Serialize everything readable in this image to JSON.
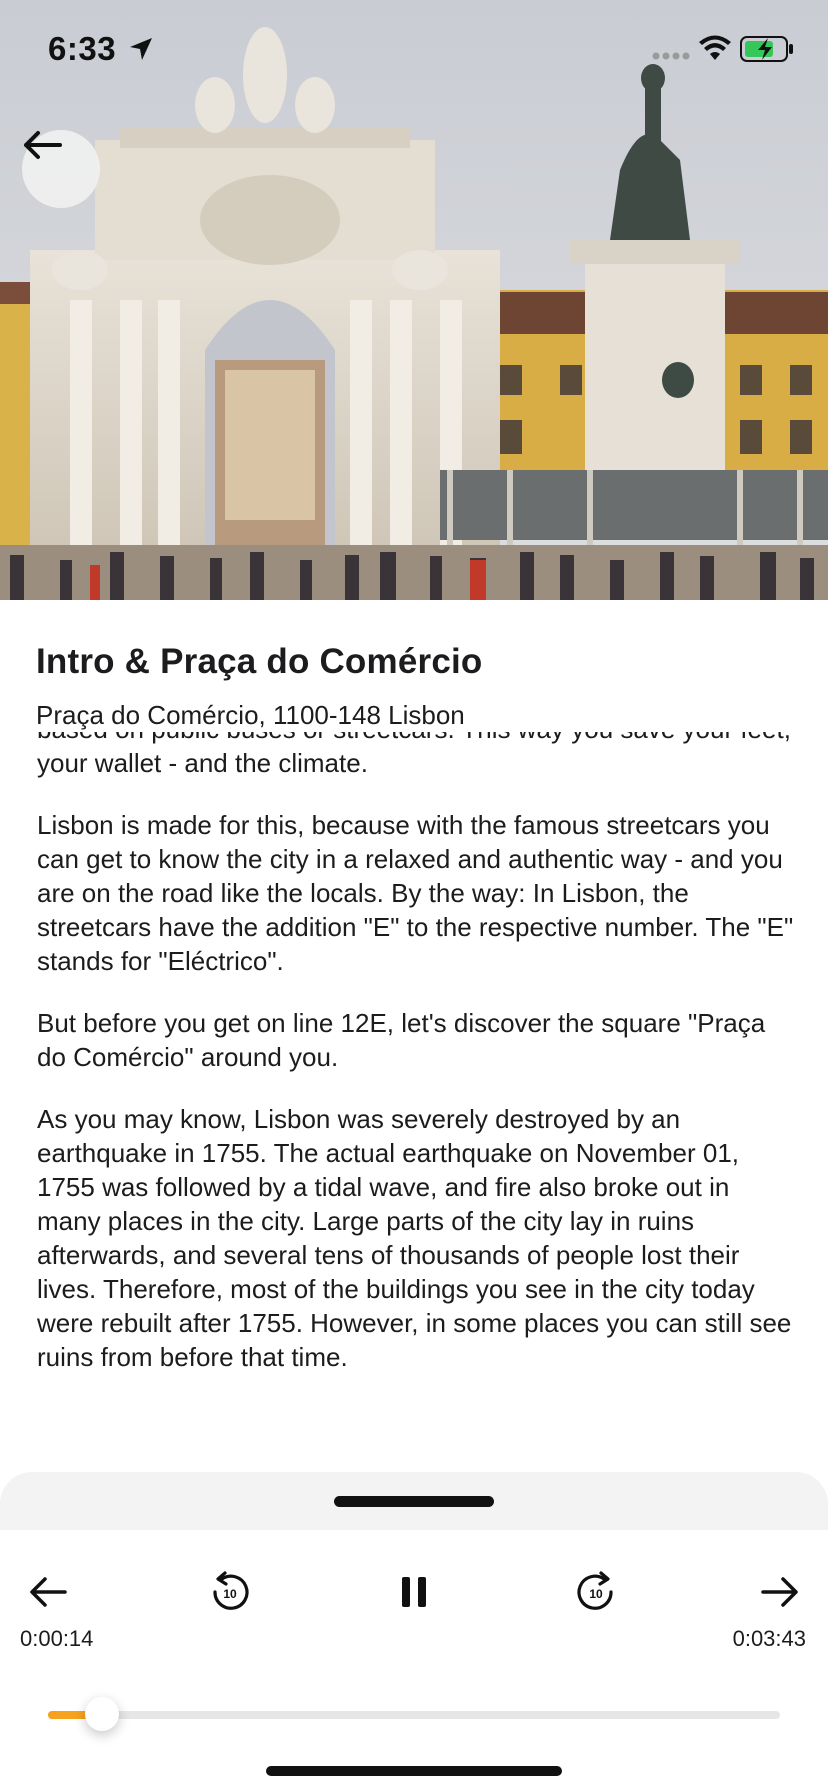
{
  "status_bar": {
    "time": "6:33",
    "icons": [
      "location-arrow-icon",
      "cellular-dots-icon",
      "wifi-icon",
      "battery-charging-icon"
    ]
  },
  "hero": {
    "image_description_icon": "photo-placeholder",
    "back_icon": "arrow-left-icon"
  },
  "place": {
    "title": "Intro & Praça do Comércio",
    "address": "Praça do Comércio, 1100-148 Lisbon"
  },
  "article": {
    "paragraphs": [
      "based on public buses or streetcars. This way you save your feet, your wallet - and the climate.",
      "Lisbon is made for this, because with the famous streetcars you can get to know the city in a relaxed and authentic way - and you are on the road like the locals. By the way: In Lisbon, the streetcars have the addition \"E\" to the respective number. The \"E\" stands for \"Eléctrico\".",
      "But before you get on line 12E, let's discover the square \"Praça do Comércio\" around you.",
      "As you may know, Lisbon was severely destroyed by an earthquake in 1755. The actual earthquake on November 01, 1755 was followed by a tidal wave, and fire also broke out in many places in the city. Large parts of the city lay in ruins afterwards, and several tens of thousands of people lost their lives. Therefore, most of the buildings you see in the city today were rebuilt after 1755. However, in some places you can still see ruins from before that time."
    ]
  },
  "player": {
    "elapsed": "0:00:14",
    "duration": "0:03:43",
    "progress_fraction": 0.063,
    "accent_color": "#f6a21e",
    "controls": {
      "previous_icon": "arrow-left-icon",
      "rewind_icon": "rewind-10-icon",
      "rewind_label": "10",
      "pause_icon": "pause-icon",
      "forward_icon": "forward-10-icon",
      "forward_label": "10",
      "next_icon": "arrow-right-icon"
    }
  }
}
